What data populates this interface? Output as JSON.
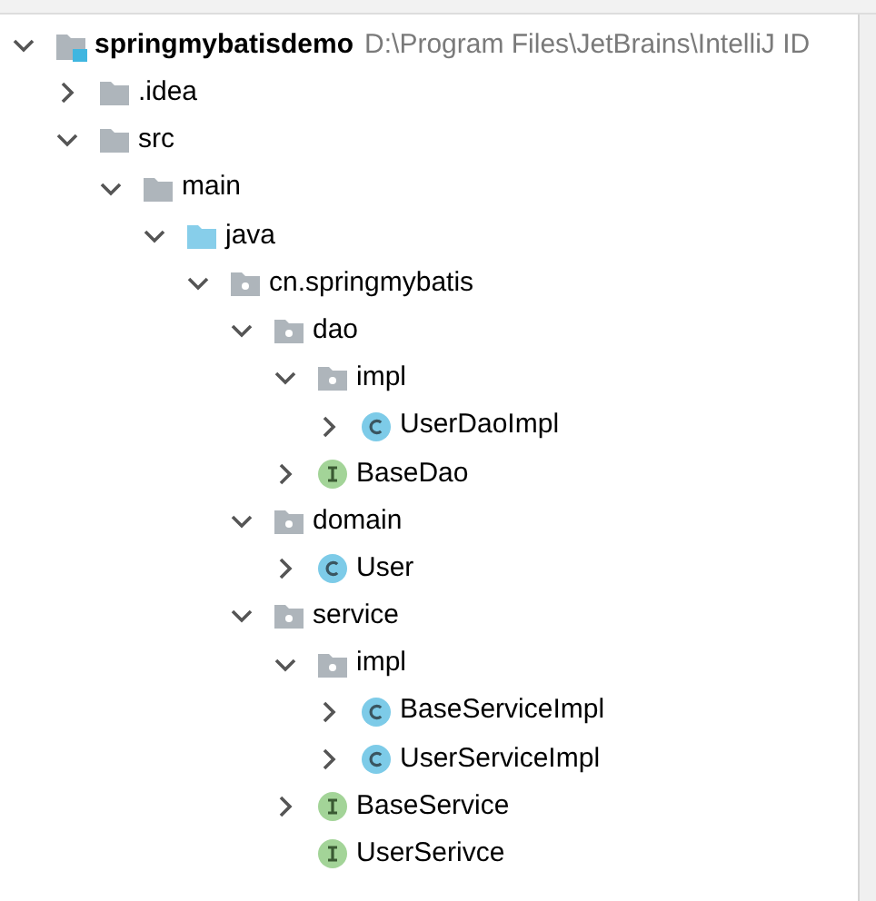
{
  "project_tree": [
    {
      "label": "springmybatisdemo",
      "kind": "module",
      "path": "D:\\Program Files\\JetBrains\\IntelliJ ID",
      "expanded": true,
      "children": [
        {
          "label": ".idea",
          "kind": "folder",
          "expanded": false
        },
        {
          "label": "src",
          "kind": "folder",
          "expanded": true,
          "children": [
            {
              "label": "main",
              "kind": "folder",
              "expanded": true,
              "children": [
                {
                  "label": "java",
                  "kind": "source-folder",
                  "expanded": true,
                  "children": [
                    {
                      "label": "cn.springmybatis",
                      "kind": "package",
                      "expanded": true,
                      "children": [
                        {
                          "label": "dao",
                          "kind": "package",
                          "expanded": true,
                          "children": [
                            {
                              "label": "impl",
                              "kind": "package",
                              "expanded": true,
                              "children": [
                                {
                                  "label": "UserDaoImpl",
                                  "kind": "class",
                                  "expanded": false
                                }
                              ]
                            },
                            {
                              "label": "BaseDao",
                              "kind": "interface",
                              "expanded": false
                            }
                          ]
                        },
                        {
                          "label": "domain",
                          "kind": "package",
                          "expanded": true,
                          "children": [
                            {
                              "label": "User",
                              "kind": "class",
                              "expanded": false
                            }
                          ]
                        },
                        {
                          "label": "service",
                          "kind": "package",
                          "expanded": true,
                          "children": [
                            {
                              "label": "impl",
                              "kind": "package",
                              "expanded": true,
                              "children": [
                                {
                                  "label": "BaseServiceImpl",
                                  "kind": "class",
                                  "expanded": false
                                },
                                {
                                  "label": "UserServiceImpl",
                                  "kind": "class",
                                  "expanded": false
                                }
                              ]
                            },
                            {
                              "label": "BaseService",
                              "kind": "interface",
                              "expanded": false
                            },
                            {
                              "label": "UserSerivce",
                              "kind": "interface"
                            }
                          ]
                        }
                      ]
                    }
                  ]
                }
              ]
            }
          ]
        }
      ]
    }
  ]
}
